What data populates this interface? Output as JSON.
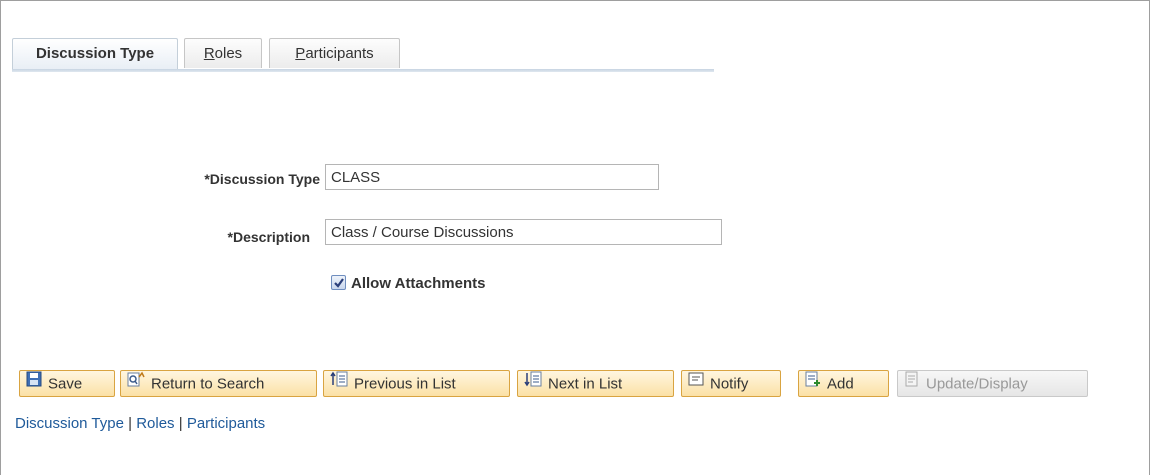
{
  "tabs": [
    {
      "label": "Discussion Type",
      "active": true
    },
    {
      "label": "Roles",
      "active": false
    },
    {
      "label": "Participants",
      "active": false
    }
  ],
  "form": {
    "discussion_type_label": "*Discussion Type",
    "discussion_type_value": "CLASS",
    "description_label": "*Description",
    "description_value": "Class / Course Discussions",
    "allow_attachments_label": "Allow Attachments",
    "allow_attachments_checked": true
  },
  "toolbar": {
    "save": "Save",
    "return_to_search": "Return to Search",
    "previous_in_list": "Previous in List",
    "next_in_list": "Next in List",
    "notify": "Notify",
    "add": "Add",
    "update_display": "Update/Display"
  },
  "bottom_links": {
    "discussion_type": "Discussion Type",
    "roles": "Roles",
    "participants": "Participants",
    "separator": "|"
  },
  "colors": {
    "link": "#1f5a9a",
    "button_border": "#d9a441",
    "button_bg": "#fbe1a6"
  }
}
